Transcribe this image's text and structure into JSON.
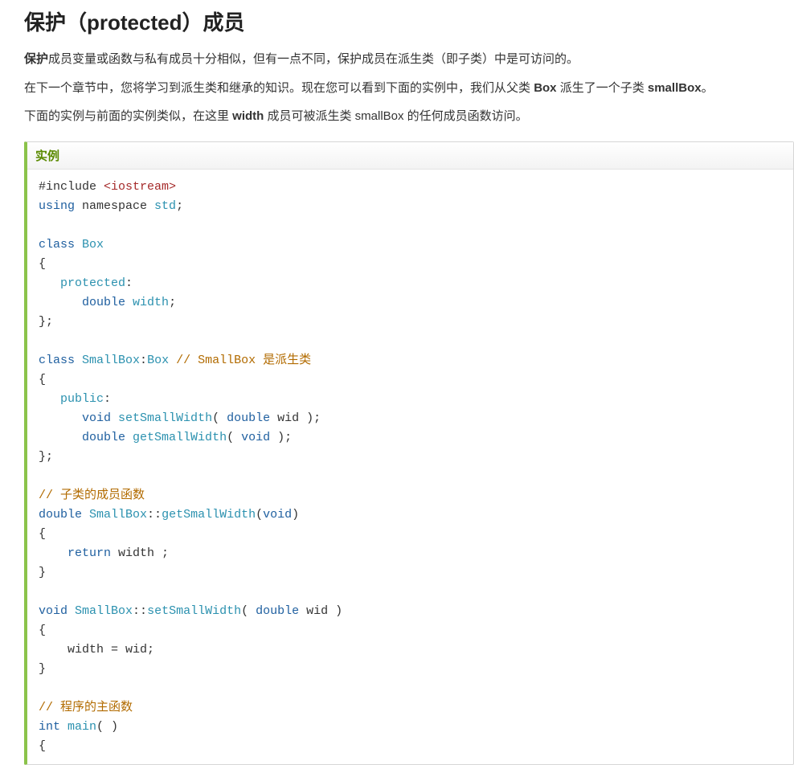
{
  "heading": "保护（protected）成员",
  "para1_bold": "保护",
  "para1_rest": "成员变量或函数与私有成员十分相似，但有一点不同，保护成员在派生类（即子类）中是可访问的。",
  "para2_a": "在下一个章节中，您将学习到派生类和继承的知识。现在您可以看到下面的实例中，我们从父类 ",
  "para2_b": "Box",
  "para2_c": " 派生了一个子类 ",
  "para2_d": "smallBox",
  "para2_e": "。",
  "para3_a": "下面的实例与前面的实例类似，在这里 ",
  "para3_b": "width",
  "para3_c": " 成员可被派生类 smallBox 的任何成员函数访问。",
  "example_label": "实例",
  "code": {
    "l1a": "#include ",
    "l1b": "<iostream>",
    "l2a": "using",
    "l2b": " namespace ",
    "l2c": "std",
    "l2d": ";",
    "blank": " ",
    "l4a": "class",
    "l4b": " ",
    "l4c": "Box",
    "l5": "{",
    "l6a": "   ",
    "l6b": "protected",
    "l6c": ":",
    "l7a": "      ",
    "l7b": "double",
    "l7c": " ",
    "l7d": "width",
    "l7e": ";",
    "l8": "};",
    "l10a": "class",
    "l10b": " ",
    "l10c": "SmallBox",
    "l10d": ":",
    "l10e": "Box",
    "l10f": " ",
    "l10g": "// SmallBox 是派生类",
    "l11": "{",
    "l12a": "   ",
    "l12b": "public",
    "l12c": ":",
    "l13a": "      ",
    "l13b": "void",
    "l13c": " ",
    "l13d": "setSmallWidth",
    "l13e": "( ",
    "l13f": "double",
    "l13g": " wid );",
    "l14a": "      ",
    "l14b": "double",
    "l14c": " ",
    "l14d": "getSmallWidth",
    "l14e": "( ",
    "l14f": "void",
    "l14g": " );",
    "l15": "};",
    "l17": "// 子类的成员函数",
    "l18a": "double",
    "l18b": " ",
    "l18c": "SmallBox",
    "l18d": "::",
    "l18e": "getSmallWidth",
    "l18f": "(",
    "l18g": "void",
    "l18h": ")",
    "l19": "{",
    "l20a": "    ",
    "l20b": "return",
    "l20c": " width ;",
    "l21": "}",
    "l23a": "void",
    "l23b": " ",
    "l23c": "SmallBox",
    "l23d": "::",
    "l23e": "setSmallWidth",
    "l23f": "( ",
    "l23g": "double",
    "l23h": " wid )",
    "l24": "{",
    "l25": "    width = wid;",
    "l26": "}",
    "l28": "// 程序的主函数",
    "l29a": "int",
    "l29b": " ",
    "l29c": "main",
    "l29d": "( )",
    "l30": "{"
  }
}
